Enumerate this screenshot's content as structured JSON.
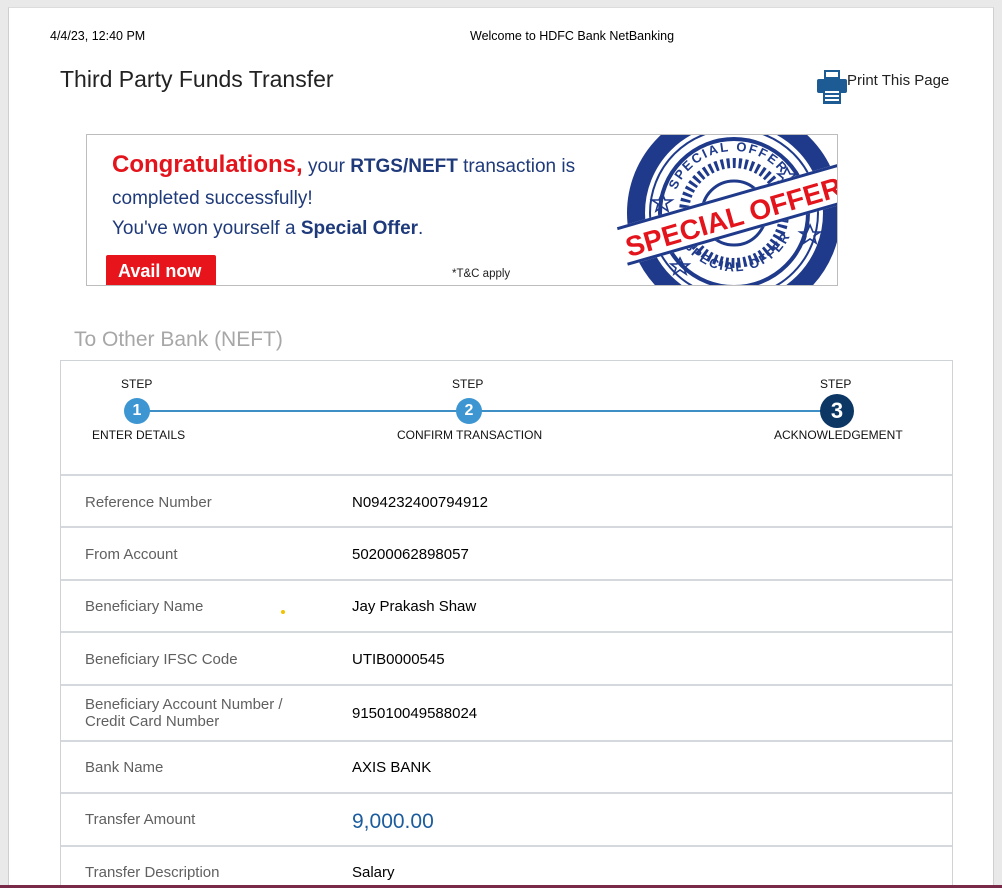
{
  "header": {
    "datetime": "4/4/23, 12:40 PM",
    "welcome": "Welcome to HDFC Bank NetBanking"
  },
  "page_title": "Third Party Funds Transfer",
  "print": {
    "label": "Print This Page",
    "icon": "printer-icon"
  },
  "banner": {
    "congrats": "Congratulations,",
    "line1_a": " your ",
    "line1_b": "RTGS/NEFT",
    "line1_c": " transaction is",
    "line2": "completed successfully!",
    "line3_a": "You've won yourself a ",
    "line3_b": "Special Offer",
    "line3_c": ".",
    "cta": "Avail now",
    "tc": "*T&C apply",
    "seal_text": "SPECIAL OFFER",
    "seal_ring_top": "SPECIAL OFFER",
    "seal_ring_bottom": "SPECIAL OFFER"
  },
  "section_title": "To Other Bank (NEFT)",
  "steps": [
    {
      "word": "STEP",
      "number": "1",
      "label": "ENTER DETAILS"
    },
    {
      "word": "STEP",
      "number": "2",
      "label": "CONFIRM TRANSACTION"
    },
    {
      "word": "STEP",
      "number": "3",
      "label": "ACKNOWLEDGEMENT"
    }
  ],
  "details": [
    {
      "label": "Reference Number",
      "value": "N094232400794912"
    },
    {
      "label": "From Account",
      "value": "50200062898057"
    },
    {
      "label": "Beneficiary Name",
      "value": "Jay Prakash Shaw"
    },
    {
      "label": "Beneficiary IFSC Code",
      "value": "UTIB0000545"
    },
    {
      "label_line1": "Beneficiary Account Number /",
      "label_line2": "Credit Card Number",
      "value": "915010049588024"
    },
    {
      "label": "Bank Name",
      "value": "AXIS BANK"
    },
    {
      "label": "Transfer Amount",
      "value": "9,000.00"
    },
    {
      "label": "Transfer Description",
      "value": "Salary"
    }
  ],
  "colors": {
    "accent_blue": "#3d96d2",
    "active_step": "#0c3764",
    "red": "#e3141b",
    "amount_blue": "#1c5c9e",
    "seal_blue": "#1f3a8a"
  }
}
